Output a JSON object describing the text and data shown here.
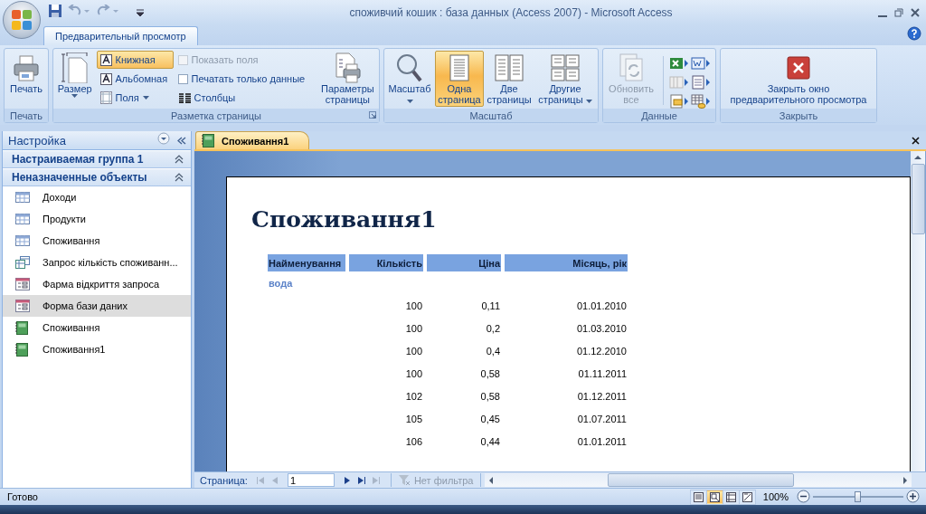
{
  "window": {
    "title": "споживчий кошик : база данных (Access 2007) - Microsoft Access"
  },
  "ribbon_tabs": [
    {
      "label": "Предварительный просмотр",
      "selected": true
    }
  ],
  "ribbon_groups": [
    {
      "kind": "print",
      "label": "Печать",
      "buttons": [
        {
          "label": "Печать"
        }
      ]
    },
    {
      "kind": "layout",
      "label": "Разметка страницы",
      "size": {
        "label": "Размер",
        "dropdown": true
      },
      "orientation": [
        {
          "label": "Книжная",
          "selected": true
        },
        {
          "label": "Альбомная",
          "selected": false
        }
      ],
      "margins": {
        "label": "Поля",
        "dropdown": true
      },
      "checkboxes": [
        {
          "label": "Показать поля",
          "checked": false,
          "disabled": true
        },
        {
          "label": "Печатать только данные",
          "checked": false,
          "disabled": false
        }
      ],
      "columns": {
        "label": "Столбцы"
      },
      "page_setup": {
        "label": "Параметры страницы"
      }
    },
    {
      "kind": "zoom",
      "label": "Масштаб",
      "buttons": [
        {
          "label": "Масштаб",
          "selected": false,
          "dropdown": true
        },
        {
          "label": "Одна страница",
          "selected": true
        },
        {
          "label": "Две страницы",
          "selected": false
        },
        {
          "label": "Другие страницы",
          "selected": false,
          "dropdown": true
        }
      ]
    },
    {
      "kind": "data",
      "label": "Данные",
      "refresh": {
        "label": "Обновить все",
        "disabled": true
      }
    },
    {
      "kind": "close",
      "label": "Закрыть",
      "buttons": [
        {
          "label": "Закрыть окно предварительного просмотра"
        }
      ]
    }
  ],
  "nav": {
    "title": "Настройка",
    "groups": [
      {
        "label": "Настраиваемая группа 1",
        "expanded": true
      },
      {
        "label": "Неназначенные объекты",
        "expanded": true,
        "items": [
          {
            "kind": "table",
            "label": "Доходи",
            "selected": false
          },
          {
            "kind": "table",
            "label": "Продукти",
            "selected": false
          },
          {
            "kind": "table",
            "label": "Споживання",
            "selected": false
          },
          {
            "kind": "query",
            "label": "Запрос кількість споживанн...",
            "selected": false
          },
          {
            "kind": "form",
            "label": "Фарма відкриття запроса",
            "selected": false
          },
          {
            "kind": "form",
            "label": "Форма бази даних",
            "selected": true
          },
          {
            "kind": "report",
            "label": "Споживання",
            "selected": false
          },
          {
            "kind": "report",
            "label": "Споживання1",
            "selected": false
          }
        ]
      }
    ]
  },
  "doc_tabs": [
    {
      "label": "Споживання1",
      "selected": true
    }
  ],
  "report": {
    "title": "Споживання1",
    "columns": [
      "Найменування",
      "Кількість",
      "Ціна",
      "Місяць, рік"
    ],
    "groups": [
      {
        "name": "вода",
        "rows": [
          [
            "100",
            "0,11",
            "01.01.2010"
          ],
          [
            "100",
            "0,2",
            "01.03.2010"
          ],
          [
            "100",
            "0,4",
            "01.12.2010"
          ],
          [
            "100",
            "0,58",
            "01.11.2011"
          ],
          [
            "102",
            "0,58",
            "01.12.2011"
          ],
          [
            "105",
            "0,45",
            "01.07.2011"
          ],
          [
            "106",
            "0,44",
            "01.01.2011"
          ]
        ]
      }
    ]
  },
  "record_nav": {
    "label": "Страница:",
    "page": "1",
    "filter": {
      "label": "Нет фильтра",
      "disabled": true
    }
  },
  "status_bar": {
    "text": "Готово",
    "views": [
      {
        "selected": false
      },
      {
        "selected": true
      },
      {
        "selected": false
      },
      {
        "selected": false
      }
    ],
    "zoom": "100%",
    "zoom_slider": {
      "level": 0.5
    }
  }
}
